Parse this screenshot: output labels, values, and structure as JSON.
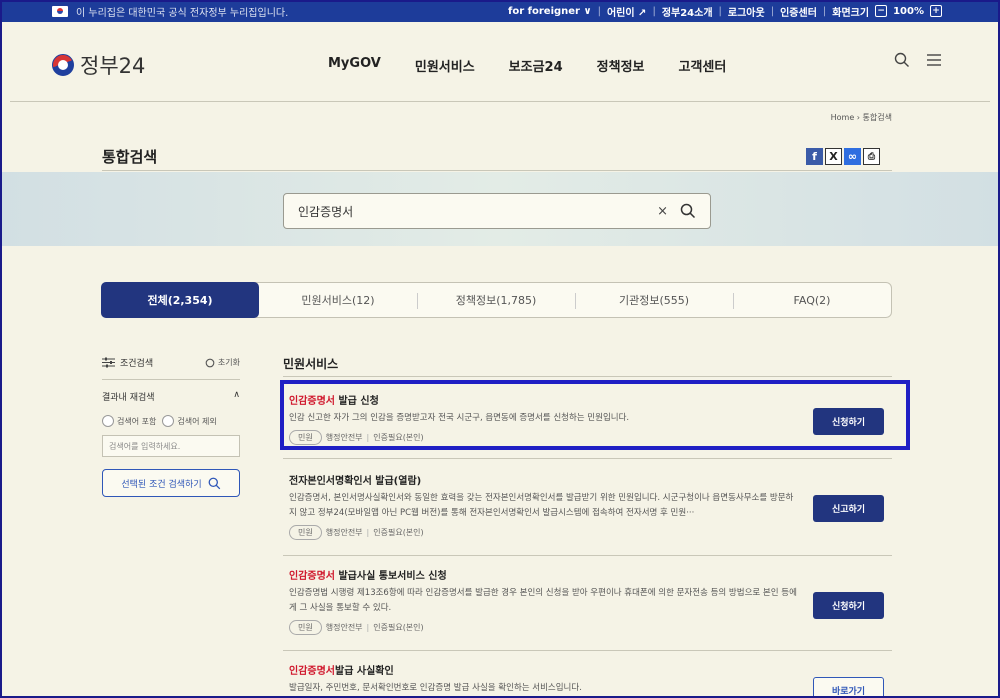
{
  "topbar": {
    "notice": "이 누리집은 대한민국 공식 전자정부 누리집입니다.",
    "links": [
      "for foreigner ∨",
      "어린이 ↗",
      "정부24소개",
      "로그아웃",
      "인증센터",
      "화면크기"
    ],
    "zoom": "100%",
    "zoom_minus": "−",
    "zoom_plus": "+"
  },
  "header": {
    "logo": "정부24",
    "nav": [
      "MyGOV",
      "민원서비스",
      "보조금24",
      "정책정보",
      "고객센터"
    ]
  },
  "breadcrumb": "Home  ›  통합검색",
  "page_title": "통합검색",
  "search": {
    "query": "인감증명서",
    "clear": "×"
  },
  "tabs": [
    {
      "label": "전체(2,354)",
      "active": true
    },
    {
      "label": "민원서비스(12)"
    },
    {
      "label": "정책정보(1,785)"
    },
    {
      "label": "기관정보(555)"
    },
    {
      "label": "FAQ(2)"
    }
  ],
  "filter": {
    "title": "조건검색",
    "reset": "초기화",
    "sub": "결과내 재검색",
    "sub_toggle": "∧",
    "include": "검색어 포함",
    "exclude": "검색어 제외",
    "placeholder": "검색어를 입력하세요.",
    "button": "선택된 조건 검색하기"
  },
  "results": {
    "section": "민원서비스",
    "items": [
      {
        "title_hl": "인감증명서",
        "title_rest": " 발급 신청",
        "desc": "인감 신고한 자가 그의 인감을 증명받고자 전국 시군구, 읍면동에 증명서를 신청하는 민원입니다.",
        "tag": "민원",
        "org": "행정안전부",
        "auth": "인증필요(본인)",
        "action": "신청하기"
      },
      {
        "title_hl": "",
        "title_rest": "전자본인서명확인서 발급(열람)",
        "desc": "인감증명서, 본인서명사실확인서와 동일한 효력을 갖는 전자본인서명확인서를 발급받기 위한 민원입니다. 시군구청이나 읍면동사무소를 방문하지 않고 정부24(모바일앱 아닌 PC웹 버전)를 통해 전자본인서명확인서 발급시스템에 접속하여 전자서명 후 민원···",
        "tag": "민원",
        "org": "행정안전부",
        "auth": "인증필요(본인)",
        "action": "신고하기"
      },
      {
        "title_hl": "인감증명서",
        "title_rest": " 발급사실 통보서비스 신청",
        "desc": "인감증명법 시행령 제13조6항에 따라 인감증명서를 발급한 경우 본인의 신청을 받아 우편이나 휴대폰에 의한 문자전송 등의 방법으로 본인 등에게 그 사실을 통보할 수 있다.",
        "tag": "민원",
        "org": "행정안전부",
        "auth": "인증필요(본인)",
        "action": "신청하기"
      },
      {
        "title_hl": "인감증명서",
        "title_rest": "발급 사실확인",
        "desc": "발급일자, 주민번호, 문서확인번호로 인감증명 발급 사실을 확인하는 서비스입니다.",
        "action": "바로가기"
      }
    ]
  },
  "colors": {
    "primary": "#22357f",
    "highlight": "#d0182d",
    "frame": "#1f1fc4"
  }
}
